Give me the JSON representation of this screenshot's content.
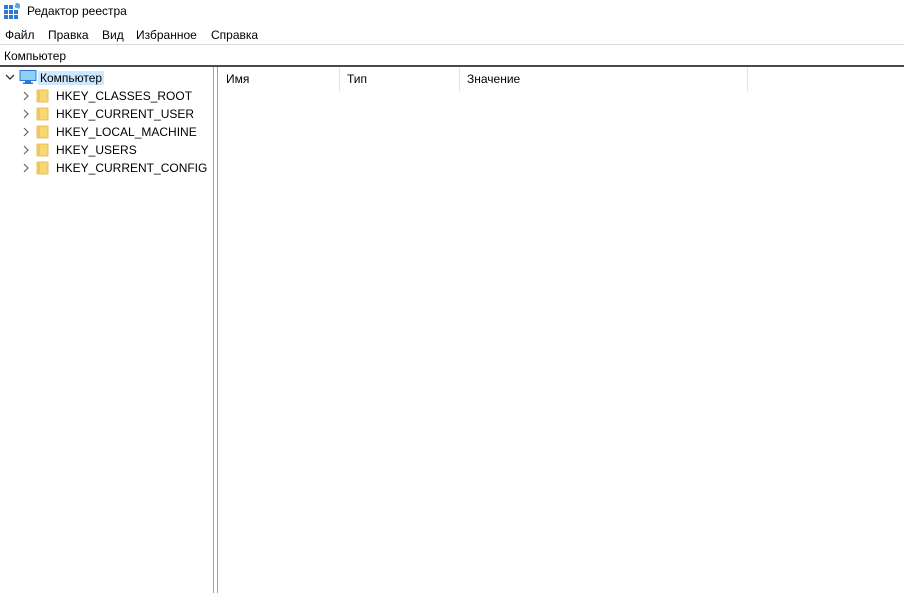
{
  "window": {
    "title": "Редактор реестра"
  },
  "menu": [
    "Файл",
    "Правка",
    "Вид",
    "Избранное",
    "Справка"
  ],
  "address": "Компьютер",
  "tree": {
    "root": "Компьютер",
    "children": [
      "HKEY_CLASSES_ROOT",
      "HKEY_CURRENT_USER",
      "HKEY_LOCAL_MACHINE",
      "HKEY_USERS",
      "HKEY_CURRENT_CONFIG"
    ]
  },
  "list": {
    "columns": [
      "Имя",
      "Тип",
      "Значение"
    ]
  },
  "icons": {
    "app": "registry-editor-icon",
    "root": "computer-icon",
    "node": "folder-icon",
    "expand": "chevron-right-icon",
    "collapse": "chevron-down-icon"
  },
  "colors": {
    "selection": "#cce8ff",
    "folder": "#f8d775",
    "accent": "#0078d7"
  }
}
